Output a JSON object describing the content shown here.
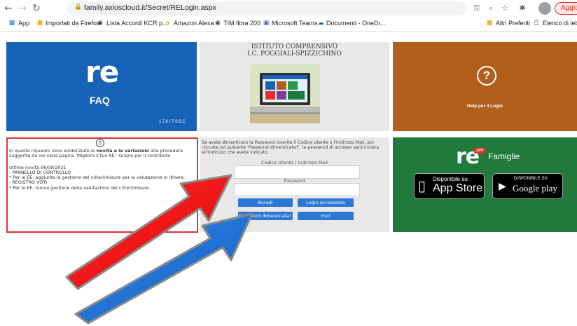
{
  "browser": {
    "url": "family.axioscloud.it/Secret/RELogin.aspx",
    "update_label": "Aggiorna"
  },
  "bookmarks": {
    "items": [
      "App",
      "Importati da Firefox",
      "Lista Accordi KCR p...",
      "Amazon Alexa",
      "TIM fibra 200",
      "Microsoft Teams",
      "Documenti - OneDr..."
    ],
    "other": "Altri Preferiti",
    "reading": "Elenco di lettura"
  },
  "faq": {
    "logo": "re",
    "label": "FAQ",
    "version": "1.7.0 / 7.0.0.C"
  },
  "school": {
    "title1": "ISTITUTO COMPRENSIVO",
    "title2": "I.C. POGGIALI-SPIZZICHINO"
  },
  "help": {
    "label": "Help per il Login"
  },
  "news": {
    "intro_a": "In questo riquadro sono evidenziate le ",
    "intro_b1": "novità e le variazioni",
    "intro_c": " alla procedura suggerite da voi nella pagina 'Migliora il tuo RE'. Grazie per il contributo.",
    "line1": "Ultime novità 06/09/2021",
    "line2": "- PANNELLO DI CONTROLLO",
    "line3": "  * Per le EE, aggiunta la gestione dei criteri/misure per la valutazione in itinere.",
    "line4": "- REGISTRO VOTI",
    "line5": "  * Per le EE, nuova gestione della valutazione dei criteri/misure."
  },
  "login": {
    "help": "Se avete dimenticato la Password inserite il Codice Utente o l'Indirizzo Mail, poi cliccate sul pulsante 'Password dimenticata?', la password di accesso sarà inviata all'indirizzo che avete indicato.",
    "user_label": "Codice Utente / Indirizzo Mail",
    "password_label": "Password",
    "user_value": "",
    "password_value": "",
    "btn_login": "Accedi",
    "btn_accessible": "Login Accessibile",
    "btn_forgot": "Password dimenticata?",
    "btn_exit": "Esci"
  },
  "app": {
    "logo": "re",
    "badge": "APP",
    "title": "Famiglie",
    "appstore_small": "Disponibile su",
    "appstore_big": "App Store",
    "gplay_small": "DISPONIBILE SU",
    "gplay_big": "Google play"
  },
  "colors": {
    "arrow_red": "#ff1a1a",
    "arrow_blue": "#1a6fd0",
    "faq_blue": "#1763b8",
    "help_brown": "#b25f1c",
    "app_green": "#1f7a3c",
    "button_blue": "#2a77d4"
  }
}
